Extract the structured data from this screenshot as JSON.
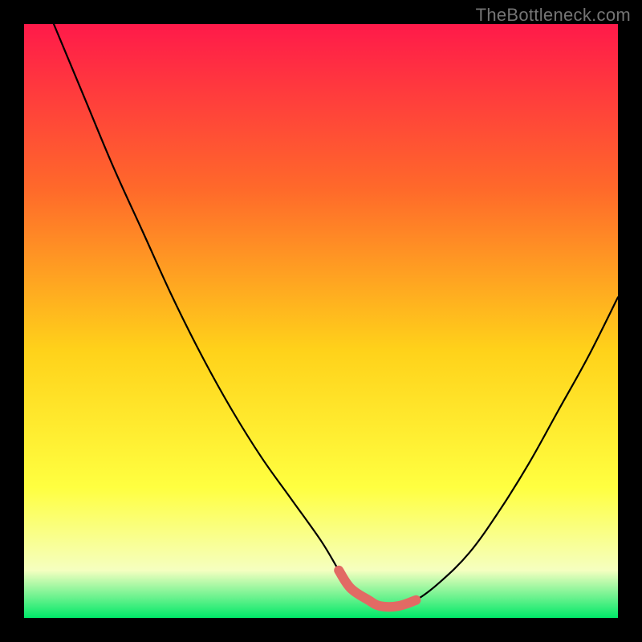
{
  "credit": "TheBottleneck.com",
  "colors": {
    "bg_black": "#000000",
    "gradient_top": "#ff1a4a",
    "gradient_mid_high": "#ff6a2a",
    "gradient_mid": "#ffd21a",
    "gradient_mid_low": "#ffff40",
    "gradient_low": "#f5ffc0",
    "gradient_bottom": "#00e868",
    "curve": "#000000",
    "marker": "#e26a64"
  },
  "chart_data": {
    "type": "line",
    "title": "",
    "xlabel": "",
    "ylabel": "",
    "xlim": [
      0,
      100
    ],
    "ylim": [
      0,
      100
    ],
    "annotations": [],
    "series": [
      {
        "name": "bottleneck-curve",
        "x": [
          5,
          10,
          15,
          20,
          25,
          30,
          35,
          40,
          45,
          50,
          53,
          55,
          58,
          60,
          63,
          66,
          70,
          75,
          80,
          85,
          90,
          95,
          100
        ],
        "y": [
          100,
          88,
          76,
          65,
          54,
          44,
          35,
          27,
          20,
          13,
          8,
          5,
          3,
          2,
          2,
          3,
          6,
          11,
          18,
          26,
          35,
          44,
          54
        ]
      },
      {
        "name": "optimal-zone",
        "x": [
          53,
          55,
          58,
          60,
          63,
          66
        ],
        "y": [
          8,
          5,
          3,
          2,
          2,
          3
        ]
      }
    ]
  }
}
